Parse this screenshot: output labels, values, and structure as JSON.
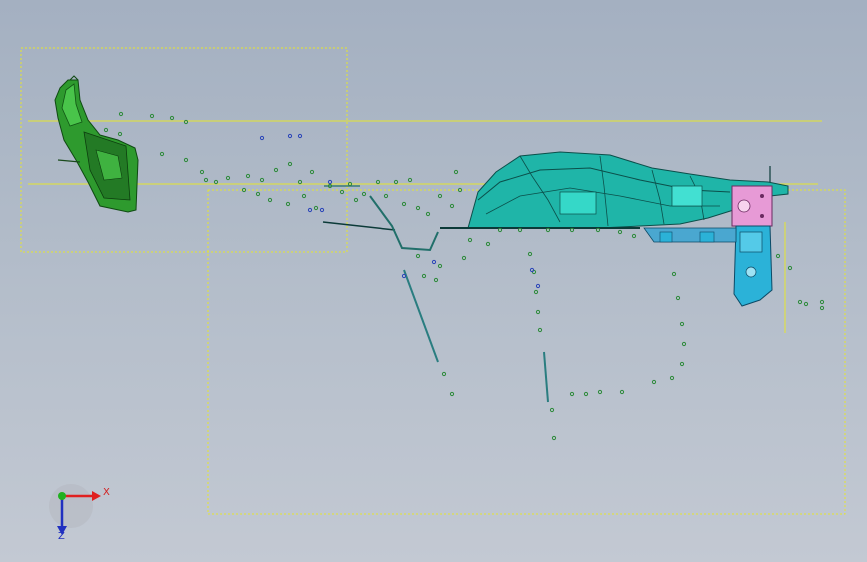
{
  "window": {
    "title": ""
  },
  "triad": {
    "x_label": "X",
    "z_label": "Z"
  },
  "colors": {
    "background_top": "#a4b0c1",
    "background_bottom": "#c3c9d3",
    "bounding_box": "#e6e62e",
    "part_green": "#2e9a2e",
    "part_teal": "#1fb5a8",
    "part_cyan": "#2bb2d8",
    "part_pink": "#e79ad6",
    "axis_x": "#e02020",
    "axis_y": "#20b020",
    "axis_z": "#2030c0"
  }
}
